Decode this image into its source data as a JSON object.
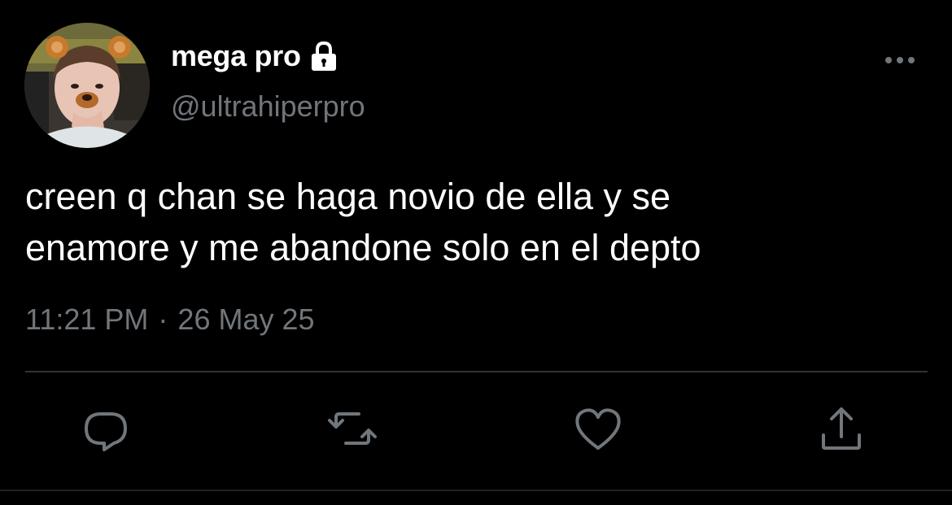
{
  "tweet": {
    "author": {
      "display_name": "mega pro",
      "handle": "@ultrahiperpro",
      "protected_icon": "lock-icon",
      "avatar_icon": "avatar"
    },
    "text": "creen q chan se haga novio de ella y se\nenamore y me abandone solo en el depto",
    "time": "11:21 PM",
    "separator": "·",
    "date": "26 May 25",
    "actions": [
      {
        "name": "reply",
        "icon": "reply-icon"
      },
      {
        "name": "retweet",
        "icon": "retweet-icon"
      },
      {
        "name": "like",
        "icon": "heart-icon"
      },
      {
        "name": "share",
        "icon": "share-icon"
      }
    ],
    "more_icon": "more-icon"
  },
  "colors": {
    "background": "#000000",
    "text_primary": "#ffffff",
    "text_secondary": "#71767b",
    "divider": "#2f3336"
  }
}
